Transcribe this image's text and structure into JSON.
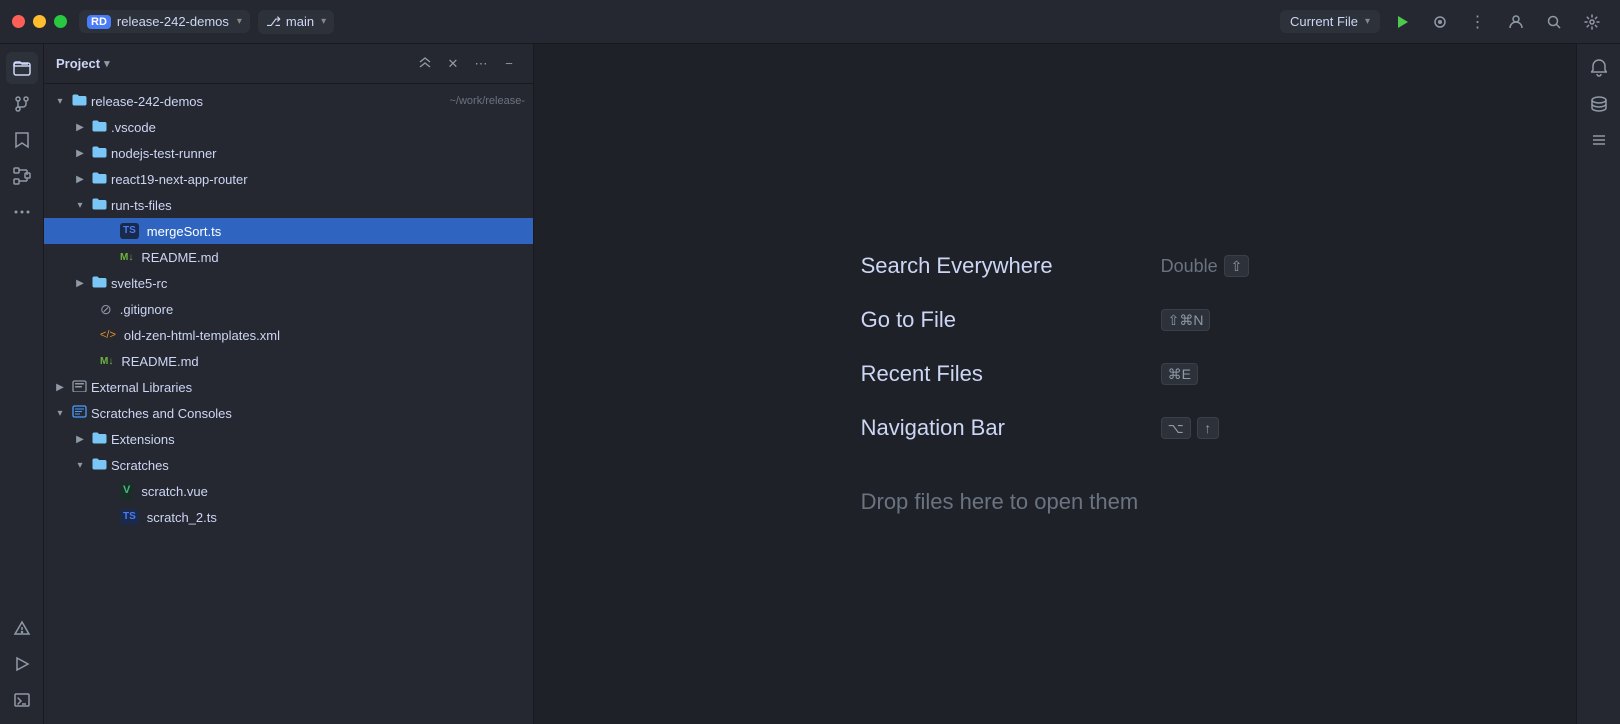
{
  "titlebar": {
    "project_name": "release-242-demos",
    "rd_badge": "RD",
    "branch_icon": "⎇",
    "branch_name": "main",
    "current_file_label": "Current File",
    "run_icon": "▶",
    "settings_icon": "⚙",
    "more_icon": "⋮",
    "user_icon": "👤",
    "search_icon": "🔍",
    "prefs_icon": "⚙"
  },
  "panel": {
    "title": "Project",
    "chevron": "▾",
    "actions": {
      "collapse": "⊼",
      "close": "✕",
      "more": "⋯",
      "minimize": "−"
    }
  },
  "tree": {
    "root": {
      "label": "release-242-demos",
      "hint": "~/work/release-",
      "expanded": true
    },
    "items": [
      {
        "id": "vscode",
        "label": ".vscode",
        "type": "folder",
        "depth": 1,
        "expanded": false
      },
      {
        "id": "nodejs",
        "label": "nodejs-test-runner",
        "type": "folder",
        "depth": 1,
        "expanded": false
      },
      {
        "id": "react19",
        "label": "react19-next-app-router",
        "type": "folder",
        "depth": 1,
        "expanded": false
      },
      {
        "id": "run-ts-files",
        "label": "run-ts-files",
        "type": "folder",
        "depth": 1,
        "expanded": true
      },
      {
        "id": "mergeSort",
        "label": "mergeSort.ts",
        "type": "ts",
        "depth": 2,
        "selected": true
      },
      {
        "id": "readme1",
        "label": "README.md",
        "type": "md",
        "depth": 2
      },
      {
        "id": "svelte5",
        "label": "svelte5-rc",
        "type": "folder",
        "depth": 1,
        "expanded": false
      },
      {
        "id": "gitignore",
        "label": ".gitignore",
        "type": "gitignore",
        "depth": 1
      },
      {
        "id": "old-zen",
        "label": "old-zen-html-templates.xml",
        "type": "xml",
        "depth": 1
      },
      {
        "id": "readme2",
        "label": "README.md",
        "type": "md",
        "depth": 1
      }
    ],
    "external_libraries": {
      "label": "External Libraries",
      "depth": 0,
      "expanded": false
    },
    "scratches_consoles": {
      "label": "Scratches and Consoles",
      "depth": 0,
      "expanded": true
    },
    "scratches_items": [
      {
        "id": "extensions",
        "label": "Extensions",
        "type": "folder",
        "depth": 1,
        "expanded": false
      },
      {
        "id": "scratches-folder",
        "label": "Scratches",
        "type": "folder",
        "depth": 1,
        "expanded": true
      },
      {
        "id": "scratch-vue",
        "label": "scratch.vue",
        "type": "vue",
        "depth": 2
      },
      {
        "id": "scratch-ts",
        "label": "scratch_2.ts",
        "type": "ts",
        "depth": 2
      }
    ]
  },
  "welcome": {
    "search_label": "Search Everywhere",
    "search_shortcut_1": "Double",
    "search_shortcut_2": "⇧",
    "goto_label": "Go to File",
    "goto_shortcut": "⇧⌘N",
    "recent_label": "Recent Files",
    "recent_shortcut": "⌘E",
    "navbar_label": "Navigation Bar",
    "navbar_shortcut_1": "⌥",
    "navbar_shortcut_2": "↑",
    "drop_label": "Drop files here to open them"
  },
  "sidebar_icons": {
    "folder": "📁",
    "git": "⎇",
    "bookmark": "🔖",
    "structure": "⊞",
    "more": "•••",
    "problems": "⚠",
    "run": "▶",
    "terminal": "⊡"
  }
}
